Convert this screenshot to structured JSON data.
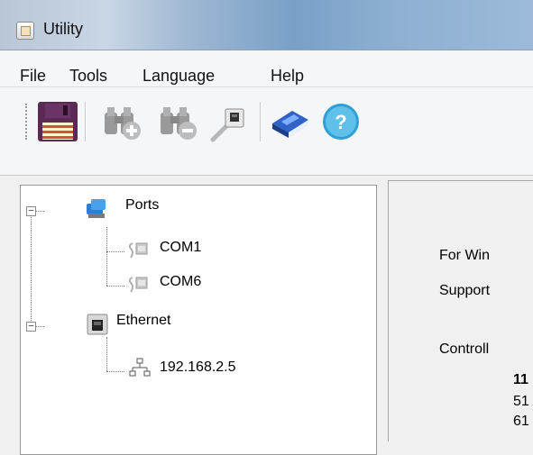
{
  "window": {
    "title": "Utility"
  },
  "menu": {
    "items": [
      "File",
      "Tools",
      "Language",
      "Help"
    ]
  },
  "toolbar": {
    "buttons": [
      {
        "name": "save-icon"
      },
      {
        "name": "search-add-icon"
      },
      {
        "name": "search-remove-icon"
      },
      {
        "name": "ethernet-plug-icon"
      },
      {
        "name": "manual-book-icon"
      },
      {
        "name": "help-icon"
      }
    ]
  },
  "tree": {
    "ports_label": "Ports",
    "ports_children": [
      "COM1",
      "COM6"
    ],
    "ethernet_label": "Ethernet",
    "ethernet_children": [
      "192.168.2.5"
    ]
  },
  "content": {
    "line1": "For Win",
    "line2": "Support",
    "line3": "Controll",
    "line4": "11",
    "line5": "51",
    "line6": "61"
  }
}
